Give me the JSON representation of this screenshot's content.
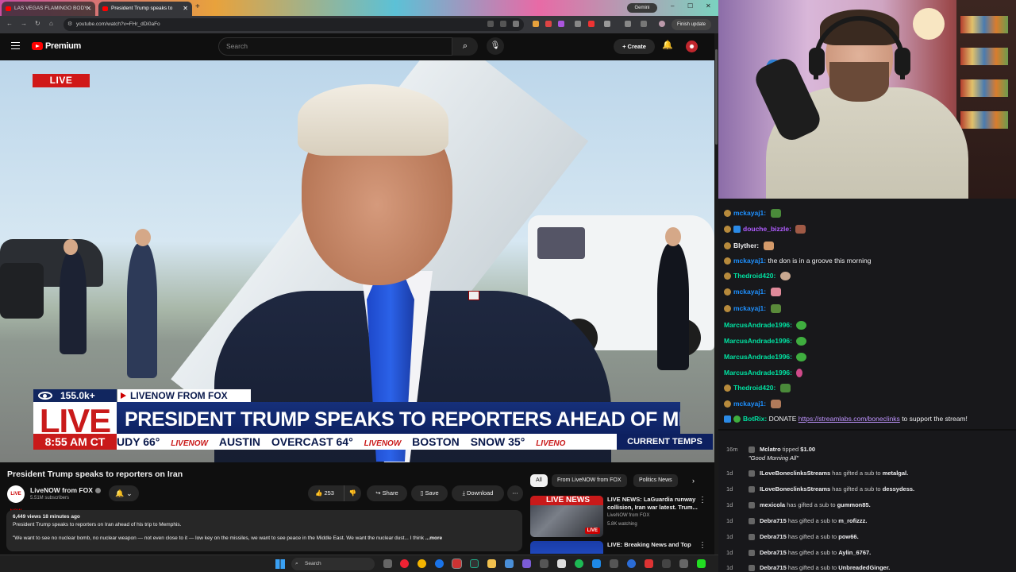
{
  "browser": {
    "tabs": [
      {
        "label": "LAS VEGAS FLAMINGO BODY..."
      },
      {
        "label": "President Trump speaks to"
      }
    ],
    "gemini_label": "Gemini",
    "url": "youtube.com/watch?v=FHr_dDi0aFo",
    "finish_update_label": "Finish update"
  },
  "youtube": {
    "brand": "Premium",
    "search_placeholder": "Search",
    "create_label": "Create"
  },
  "video": {
    "live_badge": "LIVE",
    "lower_third": {
      "views": "155.0k+",
      "source": "LIVENOW FROM FOX",
      "live": "LIVE",
      "headline": "PRESIDENT TRUMP SPEAKS TO REPORTERS AHEAD OF MEMPHIS TRIP",
      "time": "8:55 AM CT",
      "ticker": [
        "UDY 66°",
        "LIVENOW",
        "AUSTIN",
        "OVERCAST 64°",
        "LIVENOW",
        "BOSTON",
        "SNOW 35°",
        "LIVENO"
      ],
      "current_temps": "CURRENT TEMPS"
    }
  },
  "watch": {
    "title": "President Trump speaks to reporters on Iran",
    "channel_avatar_text": "LiVE NOW",
    "channel": "LiveNOW from FOX",
    "subscribers": "5.51M subscribers",
    "likes": "253",
    "share_label": "Share",
    "save_label": "Save",
    "download_label": "Download",
    "description": {
      "stats": "6,449 views  18 minutes ago",
      "line1": "President Trump speaks to reporters on Iran ahead of his trip to Memphis.",
      "line2": "\"We want to see no nuclear bomb, no nuclear weapon — not even close to it — low key on the missiles, we want to see peace in the Middle East. We want the nuclear dust... I think",
      "more": "...more"
    }
  },
  "related": {
    "chips": [
      "All",
      "From LiveNOW from FOX",
      "Politics News"
    ],
    "items": [
      {
        "thumb_text": "LIVE NEWS",
        "badge": "LIVE",
        "title": "LIVE NEWS: LaGuardia runway collision, Iran war latest. Trum...",
        "channel": "LiveNOW from FOX",
        "meta": "5.8K watching"
      },
      {
        "title": "LIVE: Breaking News and Top"
      }
    ]
  },
  "chat": {
    "messages": [
      {
        "user": "mckayaj1:",
        "text": "",
        "color": "#1e90ff"
      },
      {
        "user": "douche_bizzle:",
        "text": "",
        "color": "#b05cff"
      },
      {
        "user": "Blyther:",
        "text": "",
        "color": "#efeff1"
      },
      {
        "user": "mckayaj1:",
        "text": "the don is in a groove this morning",
        "color": "#1e90ff"
      },
      {
        "user": "Thedroid420:",
        "text": "",
        "color": "#00e0a0"
      },
      {
        "user": "mckayaj1:",
        "text": "",
        "color": "#1e90ff"
      },
      {
        "user": "mckayaj1:",
        "text": "",
        "color": "#1e90ff"
      },
      {
        "user": "MarcusAndrade1996:",
        "text": "",
        "color": "#00e0a0"
      },
      {
        "user": "MarcusAndrade1996:",
        "text": "",
        "color": "#00e0a0"
      },
      {
        "user": "MarcusAndrade1996:",
        "text": "",
        "color": "#00e0a0"
      },
      {
        "user": "MarcusAndrade1996:",
        "text": "",
        "color": "#00e0a0"
      },
      {
        "user": "Thedroid420:",
        "text": "",
        "color": "#00e0a0"
      },
      {
        "user": "mckayaj1:",
        "text": "",
        "color": "#1e90ff"
      }
    ],
    "bot": {
      "user": "BotRix:",
      "pre": "DONATE",
      "link": "https://streamlabs.com/boneclinks",
      "post": "to support the stream!"
    }
  },
  "events": [
    {
      "time": "16m",
      "name": "Mclatro",
      "text": "tipped",
      "amount": "$1.00",
      "quote": "\"Good Morning All\""
    },
    {
      "time": "1d",
      "name": "ILoveBoneclinksStreams",
      "text": "has gifted a sub to",
      "target": "metalgal."
    },
    {
      "time": "1d",
      "name": "ILoveBoneclinksStreams",
      "text": "has gifted a sub to",
      "target": "dessydess."
    },
    {
      "time": "1d",
      "name": "mexicola",
      "text": "has gifted a sub to",
      "target": "gummon85."
    },
    {
      "time": "1d",
      "name": "Debra715",
      "text": "has gifted a sub to",
      "target": "m_rofizzz."
    },
    {
      "time": "1d",
      "name": "Debra715",
      "text": "has gifted a sub to",
      "target": "pow66."
    },
    {
      "time": "1d",
      "name": "Debra715",
      "text": "has gifted a sub to",
      "target": "Aylin_6767."
    },
    {
      "time": "1d",
      "name": "Debra715",
      "text": "has gifted a sub to",
      "target": "UnbreadedGinger."
    }
  ],
  "taskbar": {
    "search_placeholder": "Search"
  }
}
